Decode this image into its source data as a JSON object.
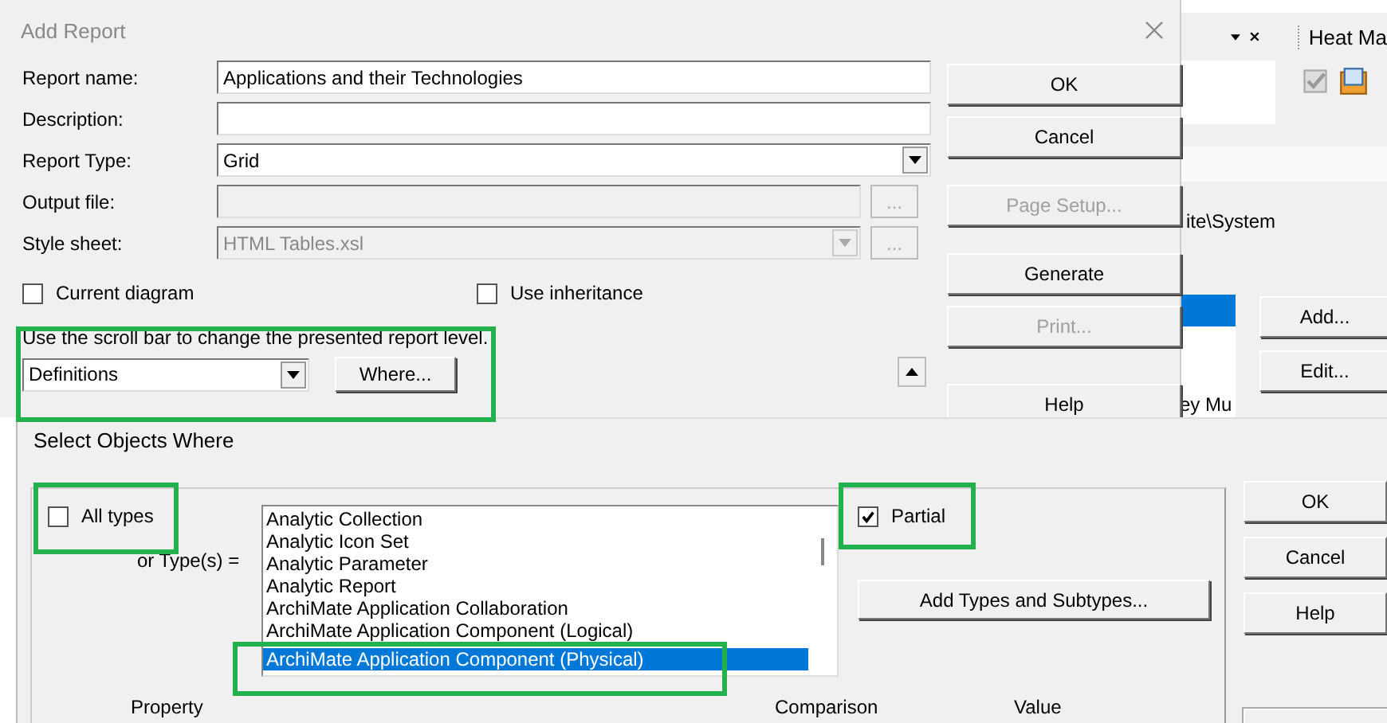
{
  "background_app": {
    "panel_title": "Heat Ma",
    "path_text": "ite\\System",
    "list_text": "ey Mu",
    "buttons": [
      "Add...",
      "Edit..."
    ]
  },
  "add_report": {
    "title": "Add Report",
    "fields": [
      {
        "label": "Report name:",
        "kind": "text",
        "disabled": false,
        "value": "Applications and their Technologies"
      },
      {
        "label": "Description:",
        "kind": "text",
        "disabled": false
      },
      {
        "label": "Report Type:",
        "kind": "combo",
        "disabled": false,
        "value": "Grid"
      },
      {
        "label": "Output file:",
        "kind": "browse",
        "disabled": true,
        "browse_label": "..."
      },
      {
        "label": "Style sheet:",
        "kind": "combo-browse",
        "disabled": true,
        "value": "HTML Tables.xsl",
        "browse_label": "..."
      }
    ],
    "options": [
      {
        "label": "Current diagram",
        "checked": false
      },
      {
        "label": "Use inheritance",
        "checked": false
      }
    ],
    "hint": "Use the scroll bar to change the presented report level.",
    "level_select": "Definitions",
    "where_button": "Where...",
    "buttons": [
      {
        "label": "OK",
        "disabled": false
      },
      {
        "label": "Cancel",
        "disabled": false
      },
      {
        "label": "Page Setup...",
        "disabled": true
      },
      {
        "label": "Generate",
        "disabled": false
      },
      {
        "label": "Print...",
        "disabled": true
      },
      {
        "label": "Help",
        "disabled": false
      }
    ]
  },
  "select_objects": {
    "title": "Select Objects Where",
    "all_types": {
      "label": "All types",
      "checked": false
    },
    "types_label": "or Type(s) =",
    "types": [
      {
        "label": "Analytic Collection",
        "selected": false
      },
      {
        "label": "Analytic Icon Set",
        "selected": false
      },
      {
        "label": "Analytic Parameter",
        "selected": false
      },
      {
        "label": "Analytic Report",
        "selected": false
      },
      {
        "label": "ArchiMate Application Collaboration",
        "selected": false
      },
      {
        "label": "ArchiMate Application Component (Logical)",
        "selected": false
      },
      {
        "label": "ArchiMate Application Component (Physical)",
        "selected": true
      }
    ],
    "partial": {
      "label": "Partial",
      "checked": true
    },
    "add_types_button": "Add Types and Subtypes...",
    "buttons": [
      "OK",
      "Cancel",
      "Help"
    ],
    "columns": [
      "Property",
      "Comparison",
      "Value"
    ]
  }
}
